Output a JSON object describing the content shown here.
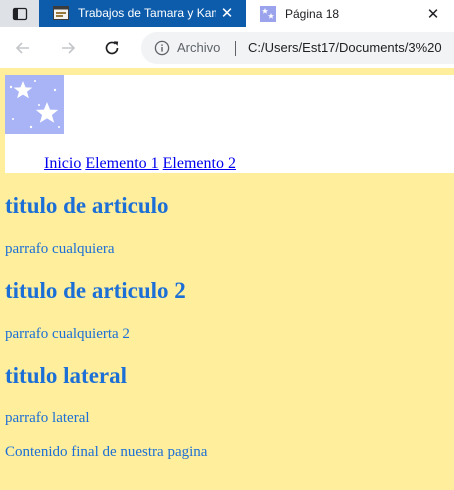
{
  "browser": {
    "tabs": [
      {
        "title": "Trabajos de Tamara y Kamila",
        "active": false
      },
      {
        "title": "Página 18",
        "active": true
      }
    ],
    "close_glyph": "✕",
    "omnibox": {
      "security_label": "Archivo",
      "url": "C:/Users/Est17/Documents/3%20"
    },
    "colors": {
      "tabbar": "#dee1e6",
      "inactive_tab": "#0d5cab",
      "active_tab": "#ffffff"
    }
  },
  "page": {
    "background": "#ffee9c",
    "text_color": "#1b6fd6",
    "logo_icon": "stars-logo-icon",
    "nav": [
      "Inicio",
      "Elemento 1",
      "Elemento 2"
    ],
    "articles": [
      {
        "title": "titulo de articulo",
        "text": "parrafo cualquiera"
      },
      {
        "title": "titulo de articulo 2",
        "text": "parrafo cualquierta 2"
      }
    ],
    "aside": {
      "title": "titulo lateral",
      "text": "parrafo lateral"
    },
    "footer": "Contenido final de nuestra pagina"
  }
}
